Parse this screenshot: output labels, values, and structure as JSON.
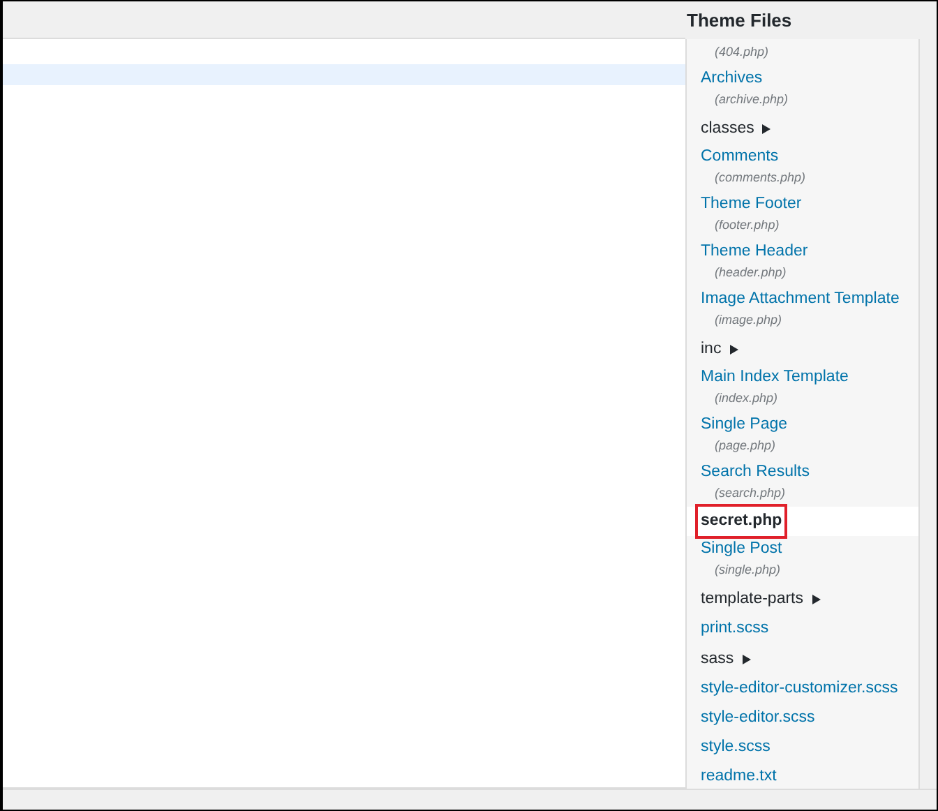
{
  "heading": "Theme Files",
  "files": [
    {
      "kind": "template",
      "file": "(404.php)",
      "selected": false
    },
    {
      "kind": "template",
      "title": "Archives",
      "file": "(archive.php)",
      "selected": false
    },
    {
      "kind": "folder",
      "name": "classes",
      "expanded": false,
      "selected": false
    },
    {
      "kind": "template",
      "title": "Comments",
      "file": "(comments.php)",
      "selected": false
    },
    {
      "kind": "template",
      "title": "Theme Footer",
      "file": "(footer.php)",
      "selected": false
    },
    {
      "kind": "template",
      "title": "Theme Header",
      "file": "(header.php)",
      "selected": false
    },
    {
      "kind": "template",
      "title": "Image Attachment Template",
      "file": "(image.php)",
      "selected": false
    },
    {
      "kind": "folder",
      "name": "inc",
      "expanded": false,
      "selected": false
    },
    {
      "kind": "template",
      "title": "Main Index Template",
      "file": "(index.php)",
      "selected": false
    },
    {
      "kind": "template",
      "title": "Single Page",
      "file": "(page.php)",
      "selected": false
    },
    {
      "kind": "template",
      "title": "Search Results",
      "file": "(search.php)",
      "selected": false
    },
    {
      "kind": "plain",
      "name": "secret.php",
      "selected": true
    },
    {
      "kind": "template",
      "title": "Single Post",
      "file": "(single.php)",
      "selected": false
    },
    {
      "kind": "folder",
      "name": "template-parts",
      "expanded": false,
      "selected": false
    },
    {
      "kind": "plain",
      "name": "print.scss",
      "selected": false
    },
    {
      "kind": "folder",
      "name": "sass",
      "expanded": false,
      "selected": false
    },
    {
      "kind": "plain",
      "name": "style-editor-customizer.scss",
      "selected": false
    },
    {
      "kind": "plain",
      "name": "style-editor.scss",
      "selected": false
    },
    {
      "kind": "plain",
      "name": "style.scss",
      "selected": false
    },
    {
      "kind": "plain",
      "name": "readme.txt",
      "selected": false
    }
  ]
}
